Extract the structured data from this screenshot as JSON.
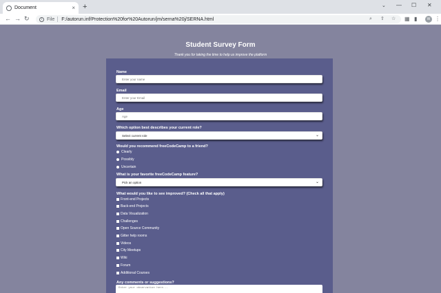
{
  "browser": {
    "tab_title": "Document",
    "tab_close": "×",
    "new_tab": "+",
    "file_label": "File",
    "url": "F:/autorun.inf/Protection%20for%20Autorun/jm/serna%20j/SERNA.html",
    "back": "←",
    "forward": "→",
    "reload": "↻",
    "minimize": "—",
    "maximize": "☐",
    "close": "✕",
    "profile_initial": "W"
  },
  "form": {
    "title": "Student Survey Form",
    "description": "Thank you for taking the time to help us improve the platform",
    "name": {
      "label": "Name",
      "placeholder": "Enter your name"
    },
    "email": {
      "label": "Email",
      "placeholder": "Enter your Email"
    },
    "age": {
      "label": "Age",
      "placeholder": "Age"
    },
    "role": {
      "label": "Which option best describes your current role?",
      "value": "Select current role"
    },
    "recommend": {
      "label": "Would you recommend freeCodeCamp to a friend?",
      "options": [
        "Clearly",
        "Possibly",
        "Uncertain"
      ]
    },
    "feature": {
      "label": "What is your favorite freeCodeCamp feature?",
      "value": "Pick an option"
    },
    "improve": {
      "label": "What would you like to see improved? (Check all that apply)",
      "options": [
        "Front-end Projects",
        "Back-end Projects",
        "Data Visualization",
        "Challenges",
        "Open Source Community",
        "Gitter help rooms",
        "Videos",
        "City Meetups",
        "Wiki",
        "Forum",
        "Additional Courses"
      ]
    },
    "comments": {
      "label": "Any comments or suggestions?",
      "placeholder": "Enter your observation here..."
    }
  }
}
